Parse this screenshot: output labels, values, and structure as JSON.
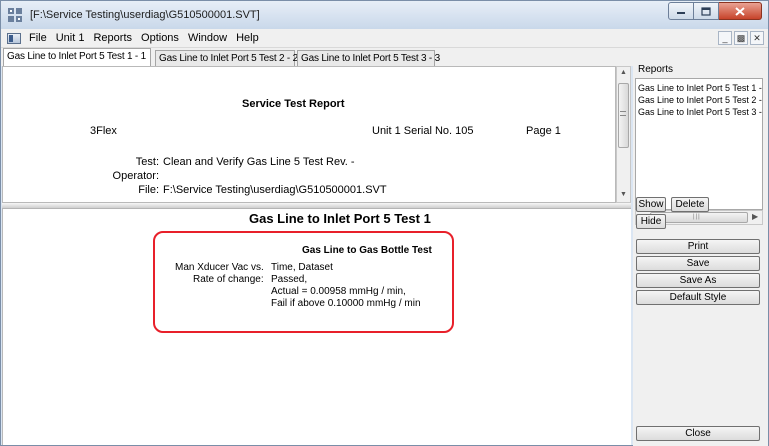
{
  "window": {
    "title": "[F:\\Service Testing\\userdiag\\G510500001.SVT]",
    "accent": "#c7432a"
  },
  "menu": [
    "File",
    "Unit 1",
    "Reports",
    "Options",
    "Window",
    "Help"
  ],
  "tabs": [
    {
      "label": "Gas Line to Inlet Port 5 Test 1 - 1",
      "active": true
    },
    {
      "label": "Gas Line to Inlet Port 5 Test 2 - 2",
      "active": false
    },
    {
      "label": "Gas Line to Inlet Port 5 Test 3 - 3",
      "active": false
    }
  ],
  "report_header": {
    "title": "Service Test Report",
    "instrument": "3Flex",
    "unit_serial": "Unit 1  Serial No. 105",
    "page": "Page 1",
    "test_label": "Test:",
    "test_value": "Clean and Verify Gas Line 5 Test Rev. -",
    "operator_label": "Operator:",
    "operator_value": "",
    "file_label": "File:",
    "file_value": "F:\\Service Testing\\userdiag\\G510500001.SVT"
  },
  "report_body": {
    "heading": "Gas Line to Inlet Port 5 Test 1",
    "subheading": "Gas Line to Gas Bottle Test",
    "line1_label": "Man Xducer Vac vs.",
    "line1_value": "Time, Dataset",
    "rate_label": "Rate of change:",
    "rate_status": "Passed,",
    "actual": "Actual = 0.00958 mmHg / min,",
    "fail_threshold": "Fail if above 0.10000 mmHg / min",
    "highlight_color": "#e8202a"
  },
  "side_panel": {
    "title": "Reports",
    "items": [
      "Gas Line to Inlet Port 5 Test 1 -",
      "Gas Line to Inlet Port 5 Test 2 -",
      "Gas Line to Inlet Port 5 Test 3 -"
    ],
    "show_label": "Show",
    "delete_label": "Delete",
    "hide_label": "Hide",
    "print_label": "Print",
    "save_label": "Save",
    "save_as_label": "Save As",
    "default_style_label": "Default Style",
    "close_label": "Close"
  }
}
